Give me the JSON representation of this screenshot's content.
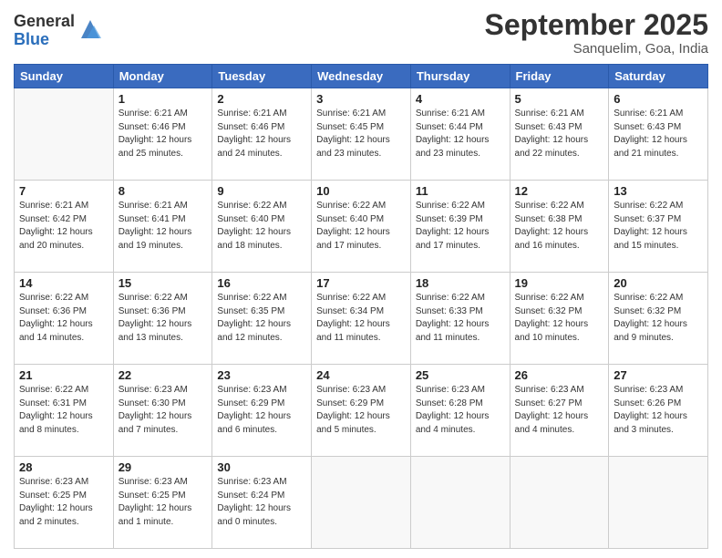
{
  "logo": {
    "general": "General",
    "blue": "Blue"
  },
  "title": "September 2025",
  "location": "Sanquelim, Goa, India",
  "days_header": [
    "Sunday",
    "Monday",
    "Tuesday",
    "Wednesday",
    "Thursday",
    "Friday",
    "Saturday"
  ],
  "weeks": [
    [
      {
        "num": "",
        "info": ""
      },
      {
        "num": "1",
        "info": "Sunrise: 6:21 AM\nSunset: 6:46 PM\nDaylight: 12 hours\nand 25 minutes."
      },
      {
        "num": "2",
        "info": "Sunrise: 6:21 AM\nSunset: 6:46 PM\nDaylight: 12 hours\nand 24 minutes."
      },
      {
        "num": "3",
        "info": "Sunrise: 6:21 AM\nSunset: 6:45 PM\nDaylight: 12 hours\nand 23 minutes."
      },
      {
        "num": "4",
        "info": "Sunrise: 6:21 AM\nSunset: 6:44 PM\nDaylight: 12 hours\nand 23 minutes."
      },
      {
        "num": "5",
        "info": "Sunrise: 6:21 AM\nSunset: 6:43 PM\nDaylight: 12 hours\nand 22 minutes."
      },
      {
        "num": "6",
        "info": "Sunrise: 6:21 AM\nSunset: 6:43 PM\nDaylight: 12 hours\nand 21 minutes."
      }
    ],
    [
      {
        "num": "7",
        "info": "Sunrise: 6:21 AM\nSunset: 6:42 PM\nDaylight: 12 hours\nand 20 minutes."
      },
      {
        "num": "8",
        "info": "Sunrise: 6:21 AM\nSunset: 6:41 PM\nDaylight: 12 hours\nand 19 minutes."
      },
      {
        "num": "9",
        "info": "Sunrise: 6:22 AM\nSunset: 6:40 PM\nDaylight: 12 hours\nand 18 minutes."
      },
      {
        "num": "10",
        "info": "Sunrise: 6:22 AM\nSunset: 6:40 PM\nDaylight: 12 hours\nand 17 minutes."
      },
      {
        "num": "11",
        "info": "Sunrise: 6:22 AM\nSunset: 6:39 PM\nDaylight: 12 hours\nand 17 minutes."
      },
      {
        "num": "12",
        "info": "Sunrise: 6:22 AM\nSunset: 6:38 PM\nDaylight: 12 hours\nand 16 minutes."
      },
      {
        "num": "13",
        "info": "Sunrise: 6:22 AM\nSunset: 6:37 PM\nDaylight: 12 hours\nand 15 minutes."
      }
    ],
    [
      {
        "num": "14",
        "info": "Sunrise: 6:22 AM\nSunset: 6:36 PM\nDaylight: 12 hours\nand 14 minutes."
      },
      {
        "num": "15",
        "info": "Sunrise: 6:22 AM\nSunset: 6:36 PM\nDaylight: 12 hours\nand 13 minutes."
      },
      {
        "num": "16",
        "info": "Sunrise: 6:22 AM\nSunset: 6:35 PM\nDaylight: 12 hours\nand 12 minutes."
      },
      {
        "num": "17",
        "info": "Sunrise: 6:22 AM\nSunset: 6:34 PM\nDaylight: 12 hours\nand 11 minutes."
      },
      {
        "num": "18",
        "info": "Sunrise: 6:22 AM\nSunset: 6:33 PM\nDaylight: 12 hours\nand 11 minutes."
      },
      {
        "num": "19",
        "info": "Sunrise: 6:22 AM\nSunset: 6:32 PM\nDaylight: 12 hours\nand 10 minutes."
      },
      {
        "num": "20",
        "info": "Sunrise: 6:22 AM\nSunset: 6:32 PM\nDaylight: 12 hours\nand 9 minutes."
      }
    ],
    [
      {
        "num": "21",
        "info": "Sunrise: 6:22 AM\nSunset: 6:31 PM\nDaylight: 12 hours\nand 8 minutes."
      },
      {
        "num": "22",
        "info": "Sunrise: 6:23 AM\nSunset: 6:30 PM\nDaylight: 12 hours\nand 7 minutes."
      },
      {
        "num": "23",
        "info": "Sunrise: 6:23 AM\nSunset: 6:29 PM\nDaylight: 12 hours\nand 6 minutes."
      },
      {
        "num": "24",
        "info": "Sunrise: 6:23 AM\nSunset: 6:29 PM\nDaylight: 12 hours\nand 5 minutes."
      },
      {
        "num": "25",
        "info": "Sunrise: 6:23 AM\nSunset: 6:28 PM\nDaylight: 12 hours\nand 4 minutes."
      },
      {
        "num": "26",
        "info": "Sunrise: 6:23 AM\nSunset: 6:27 PM\nDaylight: 12 hours\nand 4 minutes."
      },
      {
        "num": "27",
        "info": "Sunrise: 6:23 AM\nSunset: 6:26 PM\nDaylight: 12 hours\nand 3 minutes."
      }
    ],
    [
      {
        "num": "28",
        "info": "Sunrise: 6:23 AM\nSunset: 6:25 PM\nDaylight: 12 hours\nand 2 minutes."
      },
      {
        "num": "29",
        "info": "Sunrise: 6:23 AM\nSunset: 6:25 PM\nDaylight: 12 hours\nand 1 minute."
      },
      {
        "num": "30",
        "info": "Sunrise: 6:23 AM\nSunset: 6:24 PM\nDaylight: 12 hours\nand 0 minutes."
      },
      {
        "num": "",
        "info": ""
      },
      {
        "num": "",
        "info": ""
      },
      {
        "num": "",
        "info": ""
      },
      {
        "num": "",
        "info": ""
      }
    ]
  ]
}
